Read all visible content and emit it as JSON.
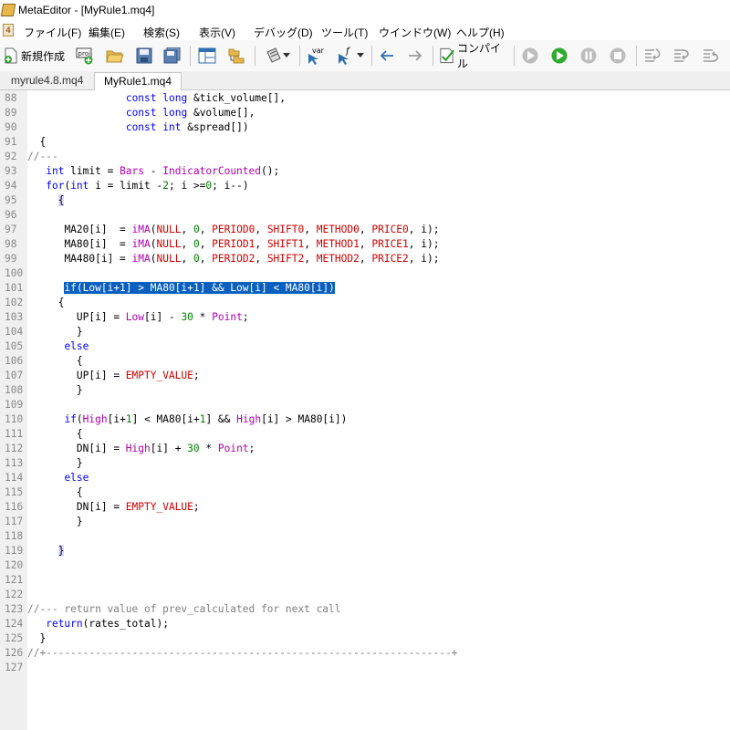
{
  "window": {
    "title": "MetaEditor - [MyRule1.mq4]"
  },
  "menu": [
    "ファイル(F)",
    "編集(E)",
    "検索(S)",
    "表示(V)",
    "デバッグ(D)",
    "ツール(T)",
    "ウインドウ(W)",
    "ヘルプ(H)"
  ],
  "toolbar": {
    "new_label": "新規作成",
    "compile_label": "コンパイル",
    "var_label": "var",
    "f_label": "f"
  },
  "tabs": [
    {
      "label": "myrule4.8.mq4",
      "active": false
    },
    {
      "label": "MyRule1.mq4",
      "active": true
    }
  ],
  "colors": {
    "keyword": "#0000ff",
    "function": "#b000b0",
    "constant": "#d00000",
    "number": "#008000",
    "comment": "#808080",
    "selection": "#0a5fbf"
  },
  "editor": {
    "lines": [
      {
        "n": "88",
        "indent": 16,
        "tokens": [
          [
            "kw",
            "const"
          ],
          [
            "tx",
            " "
          ],
          [
            "kw",
            "long"
          ],
          [
            "tx",
            " &tick_volume[],"
          ]
        ]
      },
      {
        "n": "89",
        "indent": 16,
        "tokens": [
          [
            "kw",
            "const"
          ],
          [
            "tx",
            " "
          ],
          [
            "kw",
            "long"
          ],
          [
            "tx",
            " &volume[],"
          ]
        ]
      },
      {
        "n": "90",
        "indent": 16,
        "tokens": [
          [
            "kw",
            "const"
          ],
          [
            "tx",
            " "
          ],
          [
            "kw",
            "int"
          ],
          [
            "tx",
            " &spread[])"
          ]
        ]
      },
      {
        "n": "91",
        "indent": 2,
        "tokens": [
          [
            "tx",
            "{"
          ]
        ]
      },
      {
        "n": "92",
        "indent": 0,
        "tokens": [
          [
            "cm",
            "//---"
          ]
        ]
      },
      {
        "n": "93",
        "indent": 3,
        "tokens": [
          [
            "kw",
            "int"
          ],
          [
            "tx",
            " limit = "
          ],
          [
            "fn",
            "Bars"
          ],
          [
            "tx",
            " - "
          ],
          [
            "fn",
            "IndicatorCounted"
          ],
          [
            "tx",
            "();"
          ]
        ]
      },
      {
        "n": "94",
        "indent": 3,
        "tokens": [
          [
            "kw",
            "for"
          ],
          [
            "tx",
            "("
          ],
          [
            "kw",
            "int"
          ],
          [
            "tx",
            " i = limit -"
          ],
          [
            "num",
            "2"
          ],
          [
            "tx",
            "; i >="
          ],
          [
            "num",
            "0"
          ],
          [
            "tx",
            "; i--)"
          ]
        ]
      },
      {
        "n": "95",
        "indent": 5,
        "tokens": [
          [
            "brc",
            "{"
          ]
        ]
      },
      {
        "n": "96",
        "indent": 0,
        "tokens": []
      },
      {
        "n": "97",
        "indent": 6,
        "tokens": [
          [
            "tx",
            "MA20[i]  = "
          ],
          [
            "fn",
            "iMA"
          ],
          [
            "tx",
            "("
          ],
          [
            "cn",
            "NULL"
          ],
          [
            "tx",
            ", "
          ],
          [
            "num",
            "0"
          ],
          [
            "tx",
            ", "
          ],
          [
            "cn",
            "PERIOD0"
          ],
          [
            "tx",
            ", "
          ],
          [
            "cn",
            "SHIFT0"
          ],
          [
            "tx",
            ", "
          ],
          [
            "cn",
            "METHOD0"
          ],
          [
            "tx",
            ", "
          ],
          [
            "cn",
            "PRICE0"
          ],
          [
            "tx",
            ", i);"
          ]
        ]
      },
      {
        "n": "98",
        "indent": 6,
        "tokens": [
          [
            "tx",
            "MA80[i]  = "
          ],
          [
            "fn",
            "iMA"
          ],
          [
            "tx",
            "("
          ],
          [
            "cn",
            "NULL"
          ],
          [
            "tx",
            ", "
          ],
          [
            "num",
            "0"
          ],
          [
            "tx",
            ", "
          ],
          [
            "cn",
            "PERIOD1"
          ],
          [
            "tx",
            ", "
          ],
          [
            "cn",
            "SHIFT1"
          ],
          [
            "tx",
            ", "
          ],
          [
            "cn",
            "METHOD1"
          ],
          [
            "tx",
            ", "
          ],
          [
            "cn",
            "PRICE1"
          ],
          [
            "tx",
            ", i);"
          ]
        ]
      },
      {
        "n": "99",
        "indent": 6,
        "tokens": [
          [
            "tx",
            "MA480[i] = "
          ],
          [
            "fn",
            "iMA"
          ],
          [
            "tx",
            "("
          ],
          [
            "cn",
            "NULL"
          ],
          [
            "tx",
            ", "
          ],
          [
            "num",
            "0"
          ],
          [
            "tx",
            ", "
          ],
          [
            "cn",
            "PERIOD2"
          ],
          [
            "tx",
            ", "
          ],
          [
            "cn",
            "SHIFT2"
          ],
          [
            "tx",
            ", "
          ],
          [
            "cn",
            "METHOD2"
          ],
          [
            "tx",
            ", "
          ],
          [
            "cn",
            "PRICE2"
          ],
          [
            "tx",
            ", i);"
          ]
        ]
      },
      {
        "n": "100",
        "indent": 0,
        "tokens": []
      },
      {
        "n": "101",
        "indent": 6,
        "tokens": [
          [
            "sel",
            "if(Low[i+1] > MA80[i+1] && Low[i] < MA80[i])"
          ]
        ]
      },
      {
        "n": "102",
        "indent": 5,
        "tokens": [
          [
            "tx",
            "{"
          ]
        ]
      },
      {
        "n": "103",
        "indent": 8,
        "tokens": [
          [
            "tx",
            "UP[i] = "
          ],
          [
            "fn",
            "Low"
          ],
          [
            "tx",
            "[i] - "
          ],
          [
            "num",
            "30"
          ],
          [
            "tx",
            " * "
          ],
          [
            "fn",
            "Point"
          ],
          [
            "tx",
            ";"
          ]
        ]
      },
      {
        "n": "104",
        "indent": 8,
        "tokens": [
          [
            "tx",
            "}"
          ]
        ]
      },
      {
        "n": "105",
        "indent": 6,
        "tokens": [
          [
            "kw",
            "else"
          ]
        ]
      },
      {
        "n": "106",
        "indent": 8,
        "tokens": [
          [
            "tx",
            "{"
          ]
        ]
      },
      {
        "n": "107",
        "indent": 8,
        "tokens": [
          [
            "tx",
            "UP[i] = "
          ],
          [
            "cn",
            "EMPTY_VALUE"
          ],
          [
            "tx",
            ";"
          ]
        ]
      },
      {
        "n": "108",
        "indent": 8,
        "tokens": [
          [
            "tx",
            "}"
          ]
        ]
      },
      {
        "n": "109",
        "indent": 0,
        "tokens": []
      },
      {
        "n": "110",
        "indent": 6,
        "tokens": [
          [
            "kw",
            "if"
          ],
          [
            "tx",
            "("
          ],
          [
            "fn",
            "High"
          ],
          [
            "tx",
            "[i+"
          ],
          [
            "num",
            "1"
          ],
          [
            "tx",
            "] < MA80[i+"
          ],
          [
            "num",
            "1"
          ],
          [
            "tx",
            "] && "
          ],
          [
            "fn",
            "High"
          ],
          [
            "tx",
            "[i] > MA80[i])"
          ]
        ]
      },
      {
        "n": "111",
        "indent": 8,
        "tokens": [
          [
            "tx",
            "{"
          ]
        ]
      },
      {
        "n": "112",
        "indent": 8,
        "tokens": [
          [
            "tx",
            "DN[i] = "
          ],
          [
            "fn",
            "High"
          ],
          [
            "tx",
            "[i] + "
          ],
          [
            "num",
            "30"
          ],
          [
            "tx",
            " * "
          ],
          [
            "fn",
            "Point"
          ],
          [
            "tx",
            ";"
          ]
        ]
      },
      {
        "n": "113",
        "indent": 8,
        "tokens": [
          [
            "tx",
            "}"
          ]
        ]
      },
      {
        "n": "114",
        "indent": 6,
        "tokens": [
          [
            "kw",
            "else"
          ]
        ]
      },
      {
        "n": "115",
        "indent": 8,
        "tokens": [
          [
            "tx",
            "{"
          ]
        ]
      },
      {
        "n": "116",
        "indent": 8,
        "tokens": [
          [
            "tx",
            "DN[i] = "
          ],
          [
            "cn",
            "EMPTY_VALUE"
          ],
          [
            "tx",
            ";"
          ]
        ]
      },
      {
        "n": "117",
        "indent": 8,
        "tokens": [
          [
            "tx",
            "}"
          ]
        ]
      },
      {
        "n": "118",
        "indent": 0,
        "tokens": []
      },
      {
        "n": "119",
        "indent": 5,
        "tokens": [
          [
            "brc",
            "}"
          ]
        ]
      },
      {
        "n": "120",
        "indent": 0,
        "tokens": []
      },
      {
        "n": "121",
        "indent": 0,
        "tokens": []
      },
      {
        "n": "122",
        "indent": 0,
        "tokens": []
      },
      {
        "n": "123",
        "indent": 0,
        "tokens": [
          [
            "cm",
            "//--- return value of prev_calculated for next call"
          ]
        ]
      },
      {
        "n": "124",
        "indent": 3,
        "tokens": [
          [
            "kw",
            "return"
          ],
          [
            "tx",
            "(rates_total);"
          ]
        ]
      },
      {
        "n": "125",
        "indent": 2,
        "tokens": [
          [
            "tx",
            "}"
          ]
        ]
      },
      {
        "n": "126",
        "indent": 0,
        "tokens": [
          [
            "cm",
            "//+------------------------------------------------------------------+"
          ]
        ]
      },
      {
        "n": "127",
        "indent": 0,
        "tokens": []
      }
    ]
  }
}
